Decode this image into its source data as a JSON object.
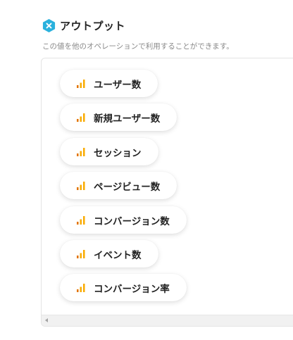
{
  "header": {
    "title": "アウトプット",
    "icon": "x-hexagon-icon",
    "icon_color": "#2ab1dd"
  },
  "description": "この値を他のオペレーションで利用することができます。",
  "outputs": [
    {
      "label": "ユーザー数",
      "icon": "bar-chart-icon"
    },
    {
      "label": "新規ユーザー数",
      "icon": "bar-chart-icon"
    },
    {
      "label": "セッション",
      "icon": "bar-chart-icon"
    },
    {
      "label": "ページビュー数",
      "icon": "bar-chart-icon"
    },
    {
      "label": "コンバージョン数",
      "icon": "bar-chart-icon"
    },
    {
      "label": "イベント数",
      "icon": "bar-chart-icon"
    },
    {
      "label": "コンバージョン率",
      "icon": "bar-chart-icon"
    }
  ],
  "colors": {
    "chart_icon_dark": "#e37400",
    "chart_icon_light": "#f9ab00"
  }
}
